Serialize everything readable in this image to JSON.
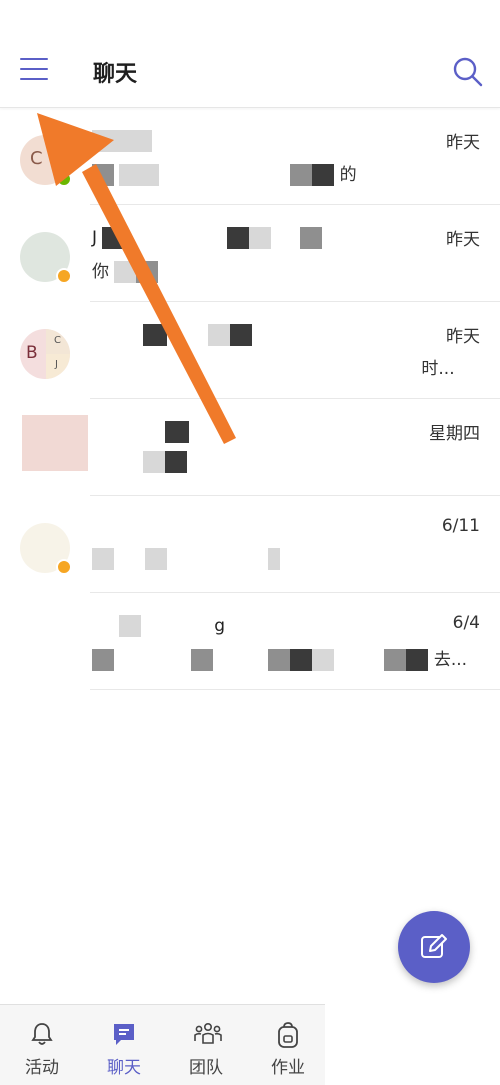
{
  "header": {
    "title": "聊天"
  },
  "chats": [
    {
      "time": "昨天",
      "avatar_text": "C",
      "line1": "",
      "line2_suffix": "的"
    },
    {
      "time": "昨天",
      "avatar_text": "",
      "line1_prefix": "J",
      "line2_prefix": "你"
    },
    {
      "time": "昨天",
      "avatar_text": "B",
      "avatar_sub": [
        "C",
        "J"
      ],
      "line1": "",
      "line2_suffix": "时..."
    },
    {
      "time": "星期四",
      "avatar_text": "",
      "line1": "",
      "line2": ""
    },
    {
      "time": "6/11",
      "avatar_text": "",
      "line1": "",
      "line2": ""
    },
    {
      "time": "6/4",
      "avatar_text": "",
      "line1_suffix": "g",
      "line2_suffix": "去..."
    }
  ],
  "nav": {
    "items": [
      {
        "label": "活动",
        "icon": "bell-icon"
      },
      {
        "label": "聊天",
        "icon": "chat-icon"
      },
      {
        "label": "团队",
        "icon": "teams-icon"
      },
      {
        "label": "作业",
        "icon": "backpack-icon"
      }
    ],
    "active_index": 1
  },
  "colors": {
    "accent": "#5b5fc7",
    "annotation_arrow": "#f07a2a"
  }
}
